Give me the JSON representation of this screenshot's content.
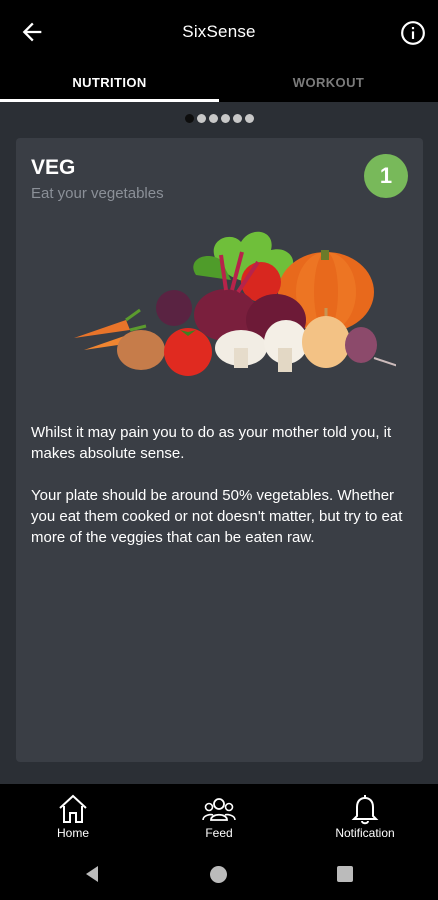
{
  "appbar": {
    "title": "SixSense",
    "back_icon": "arrow-left-icon",
    "info_icon": "info-circle-icon"
  },
  "tabs": [
    {
      "label": "NUTRITION",
      "active": true
    },
    {
      "label": "WORKOUT",
      "active": false
    }
  ],
  "pager": {
    "total": 6,
    "active_index": 0
  },
  "card": {
    "title": "VEG",
    "subtitle": "Eat your vegetables",
    "badge": "1",
    "badge_color": "#78b95a",
    "image": "vegetables-illustration",
    "paragraphs": [
      "Whilst it may pain you to do as your mother told you, it makes absolute sense.",
      "Your plate should be around 50% vegetables. Whether you eat them cooked or not doesn't matter, but try to eat more of the veggies that can be eaten raw."
    ]
  },
  "bottom_nav": [
    {
      "label": "Home",
      "icon": "home-icon"
    },
    {
      "label": "Feed",
      "icon": "group-icon"
    },
    {
      "label": "Notification",
      "icon": "bell-icon"
    }
  ],
  "system_nav": [
    "back-triangle-icon",
    "home-circle-icon",
    "recents-square-icon"
  ]
}
